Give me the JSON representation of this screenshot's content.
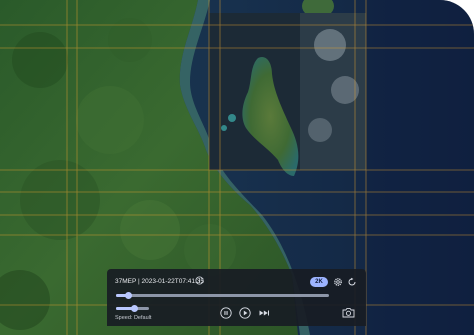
{
  "player": {
    "meta_label": "37MEP | 2023-01-22T07:41:35",
    "resolution_label": "2K",
    "speed_label": "Speed: Default",
    "timeline_progress": 0.06,
    "speed_level": 0.55
  },
  "icons": [
    "info-icon",
    "gear-icon",
    "refresh-icon",
    "stop-icon",
    "play-icon",
    "fast-forward-icon",
    "camera-icon"
  ],
  "colors": {
    "accent": "#b9c8ff",
    "badge": "#9db4ff",
    "panel": "#181c24",
    "grid": "#e0a030",
    "ocean": "#142845",
    "land": "#2f5a2a"
  }
}
